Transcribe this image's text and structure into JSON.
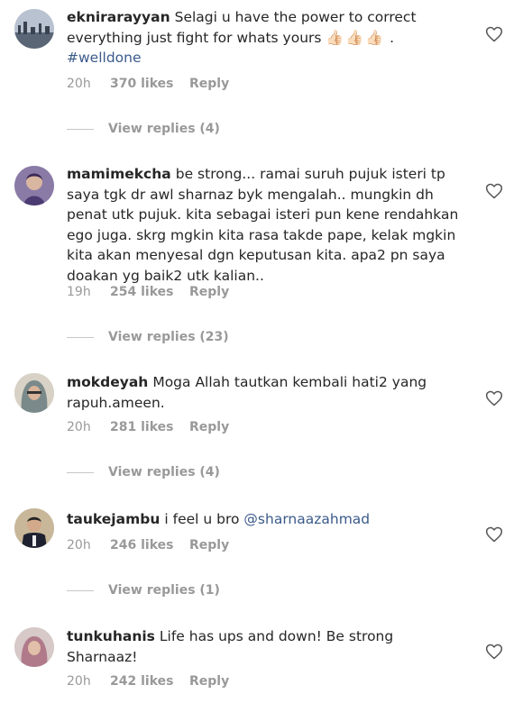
{
  "comments": [
    {
      "username": "eknirarayyan",
      "text": "Selagi u have the power to correct everything just fight for whats yours",
      "emoji": "👍🏻👍🏻👍🏻",
      "text_end": " .",
      "hashtag": "#welldone",
      "time": "20h",
      "likes": "370 likes",
      "reply": "Reply",
      "view_replies": "View replies (4)"
    },
    {
      "username": "mamimekcha",
      "text": "be strong... ramai suruh pujuk isteri tp saya tgk dr awl sharnaz byk mengalah.. mungkin dh penat utk pujuk. kita sebagai isteri pun kene rendahkan ego juga. skrg mgkin kita rasa takde pape, kelak mgkin kita akan menyesal dgn keputusan kita. apa2 pn saya doakan yg baik2 utk kalian..",
      "time": "19h",
      "likes": "254 likes",
      "reply": "Reply",
      "view_replies": "View replies (23)"
    },
    {
      "username": "mokdeyah",
      "text": "Moga Allah tautkan kembali hati2 yang rapuh.ameen.",
      "time": "20h",
      "likes": "281 likes",
      "reply": "Reply",
      "view_replies": "View replies (4)"
    },
    {
      "username": "taukejambu",
      "text": "i feel u bro",
      "mention": "@sharnaazahmad",
      "time": "20h",
      "likes": "246 likes",
      "reply": "Reply",
      "view_replies": "View replies (1)"
    },
    {
      "username": "tunkuhanis",
      "text": "Life has ups and down! Be strong Sharnaaz!",
      "time": "20h",
      "likes": "242 likes",
      "reply": "Reply"
    }
  ],
  "icons": {
    "heart": "heart-outline-icon"
  },
  "colors": {
    "text": "#262626",
    "meta": "#999999",
    "link": "#3b5a8a"
  }
}
